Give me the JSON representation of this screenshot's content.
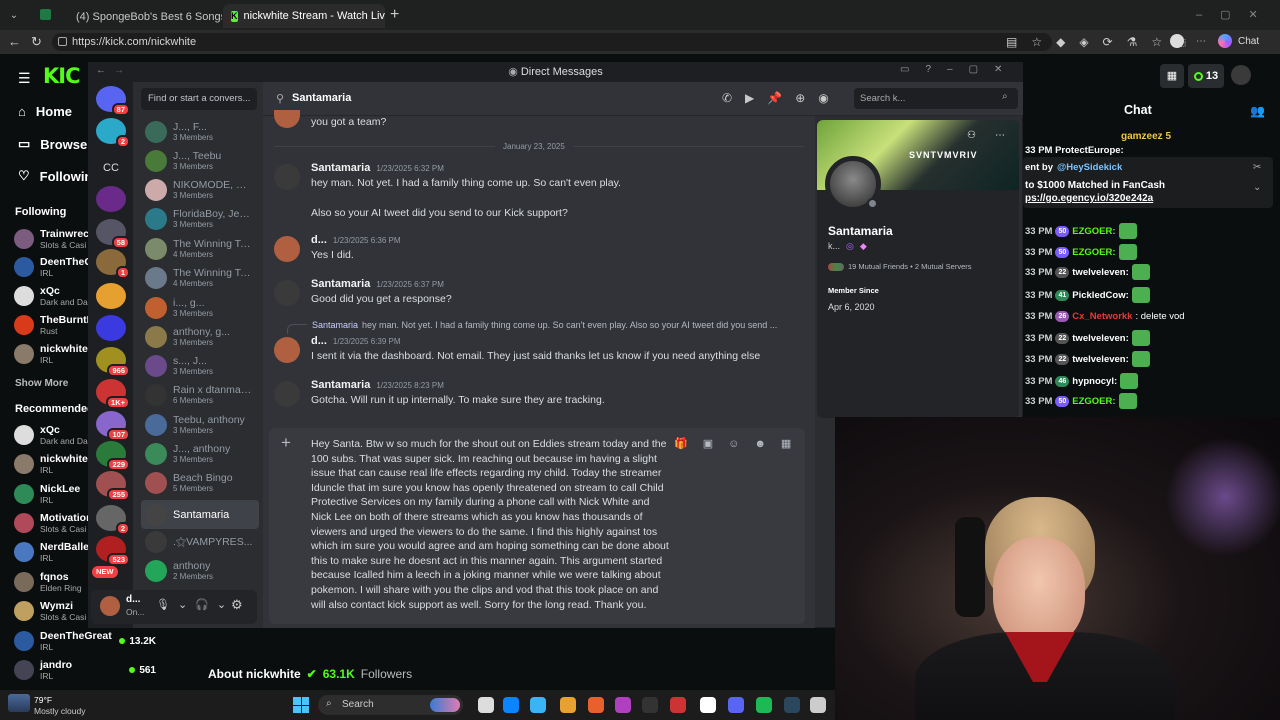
{
  "browser": {
    "tabs": [
      {
        "label": "(4) SpongeBob's Best 6 Songs 🇫🇷"
      },
      {
        "label": "nickwhite Stream - Watch Live on"
      }
    ],
    "url": "https://kick.com/nickwhite"
  },
  "kick": {
    "nav": [
      {
        "label": "Home"
      },
      {
        "label": "Browse"
      },
      {
        "label": "Following"
      }
    ],
    "following_title": "Following",
    "following": [
      {
        "name": "Trainwrec",
        "cat": "Slots & Casi"
      },
      {
        "name": "DeenTheG",
        "cat": "IRL"
      },
      {
        "name": "xQc",
        "cat": "Dark and Da"
      },
      {
        "name": "TheBurntP",
        "cat": "Rust"
      },
      {
        "name": "nickwhite",
        "cat": "IRL"
      }
    ],
    "show_more": "Show More",
    "recommended_title": "Recommended",
    "recommended": [
      {
        "name": "xQc",
        "cat": "Dark and Da",
        "count": ""
      },
      {
        "name": "nickwhite",
        "cat": "IRL",
        "count": ""
      },
      {
        "name": "NickLee",
        "cat": "IRL",
        "count": ""
      },
      {
        "name": "Motivation",
        "cat": "Slots & Casi",
        "count": ""
      },
      {
        "name": "NerdBaller",
        "cat": "IRL",
        "count": ""
      },
      {
        "name": "fqnos",
        "cat": "Elden Ring",
        "count": ""
      },
      {
        "name": "Wymzi",
        "cat": "Slots & Casi",
        "count": ""
      },
      {
        "name": "DeenTheGreat",
        "cat": "IRL",
        "count": "13.2K"
      },
      {
        "name": "jandro",
        "cat": "IRL",
        "count": "561"
      }
    ],
    "about": "About nickwhite",
    "followers_count": "63.1K",
    "followers_label": "Followers",
    "viewer_count": "13",
    "chat_title": "Chat",
    "chat_top": "gamzeez 5",
    "pinned_user": "@HeySidekick",
    "pinned_line1": "to $1000 Matched in FanCash",
    "pinned_line2": "ps://go.egency.io/320e242a",
    "pinned_prefix": "ent by",
    "chat_lines": [
      {
        "time": "33 PM",
        "badge": "50",
        "user": "EZGOER:",
        "color": "#53fc18",
        "msg": ""
      },
      {
        "time": "33 PM",
        "badge": "50",
        "user": "EZGOER:",
        "color": "#53fc18",
        "msg": ""
      },
      {
        "time": "33 PM",
        "badge": "22",
        "user": "twelveleven:",
        "color": "#ffffff",
        "msg": ""
      },
      {
        "time": "33 PM",
        "badge": "41",
        "user": "PickledCow:",
        "color": "#ffffff",
        "msg": ""
      },
      {
        "time": "33 PM",
        "badge": "26",
        "user": "Cx_Networkk",
        "color": "#e53935",
        "msg": ": delete vod"
      },
      {
        "time": "33 PM",
        "badge": "22",
        "user": "twelveleven:",
        "color": "#ffffff",
        "msg": ""
      },
      {
        "time": "33 PM",
        "badge": "22",
        "user": "twelveleven:",
        "color": "#ffffff",
        "msg": ""
      },
      {
        "time": "33 PM",
        "badge": "46",
        "user": "hypnocyl:",
        "color": "#ffffff",
        "msg": ""
      },
      {
        "time": "33 PM",
        "badge": "50",
        "user": "EZGOER:",
        "color": "#53fc18",
        "msg": ""
      }
    ],
    "chat_header_line": "33 PM ProtectEurope:"
  },
  "discord": {
    "window_title": "Direct Messages",
    "search_dm": "Find or start a convers...",
    "channel_name": "Santamaria",
    "search_placeholder": "Search k...",
    "server_badges": [
      "87",
      "2",
      "",
      "",
      "58",
      "1",
      "",
      "",
      "966",
      "1K+",
      "107",
      "229",
      "255",
      "2",
      "523"
    ],
    "new_label": "NEW",
    "cc_label": "CC",
    "dms": [
      {
        "name": "J..., F...",
        "members": "3 Members"
      },
      {
        "name": "J..., Teebu",
        "members": "3 Members"
      },
      {
        "name": "NIKOMODE, Ba...",
        "members": "3 Members"
      },
      {
        "name": "FloridaBoy, Jed...",
        "members": "3 Members"
      },
      {
        "name": "The Winning Te...",
        "members": "4 Members"
      },
      {
        "name": "The Winning Te...",
        "members": "4 Members"
      },
      {
        "name": "i..., g...",
        "members": "3 Members"
      },
      {
        "name": "anthony, g...",
        "members": "3 Members"
      },
      {
        "name": "s..., J...",
        "members": "3 Members"
      },
      {
        "name": "Rain x dtanmanb...",
        "members": "6 Members"
      },
      {
        "name": "Teebu, anthony",
        "members": "3 Members"
      },
      {
        "name": "J..., anthony",
        "members": "3 Members"
      },
      {
        "name": "Beach Bingo",
        "members": "5 Members"
      },
      {
        "name": "Santamaria",
        "members": ""
      },
      {
        "name": ".⚝VAMPYRES...",
        "members": ""
      },
      {
        "name": "anthony",
        "members": "2 Members"
      }
    ],
    "user": {
      "name": "d...",
      "status": "On..."
    },
    "date_divider": "January 23, 2025",
    "prev_text": "you got a team?",
    "messages": [
      {
        "author": "Santamaria",
        "time": "1/23/2025 6:32 PM",
        "lines": [
          "hey man.  Not yet. I had a family thing come up.  So can't even play.",
          "",
          "Also so your AI tweet did you send to our Kick support?"
        ]
      },
      {
        "author": "d...",
        "time": "1/23/2025 6:36 PM",
        "lines": [
          "Yes I did."
        ]
      },
      {
        "author": "Santamaria",
        "time": "1/23/2025 6:37 PM",
        "lines": [
          "Good did you get a response?"
        ]
      },
      {
        "author": "d...",
        "time": "1/23/2025 6:39 PM",
        "lines": [
          "I sent it via the dashboard. Not email. They just said thanks let us know if you need anything else"
        ]
      },
      {
        "author": "Santamaria",
        "time": "1/23/2025 8:23 PM",
        "lines": [
          "Gotcha. Will run it up internally. To make sure they are tracking."
        ]
      }
    ],
    "reply_author": "Santamaria",
    "reply_text": "hey man.  Not yet. I had a family thing come up.  So can't even play.  Also so your AI tweet did you send ...",
    "draft": "Hey Santa. Btw w so much for the shout out on Eddies stream today and the 100 subs. That was super sick. Im reaching out because im having a slight issue that can cause real life effects regarding my child. Today the streamer Iduncle that im sure you know has openly threatened on stream to call Child Protective Services on my family during a phone call with Nick White and Nick Lee on both of there streams which as you know has thousands of viewers and urged the viewers to do the same. I find this highly against tos which im sure you would agree and am hoping something can be done about this to make sure he doesnt act in this manner again.  This argument started because Icalled him a leech in a joking manner while we were talking about pokemon. I will share with you the clips and vod that this took place on and will also contact kick support as well. Sorry for the long read. Thank you.",
    "profile": {
      "name": "Santamaria",
      "tag": "k...",
      "mutual": "19 Mutual Friends • 2 Mutual Servers",
      "member_since_label": "Member Since",
      "member_since": "Apr 6, 2020",
      "banner_text": "SVNTVMVRIV"
    }
  },
  "taskbar": {
    "weather_temp": "79°F",
    "weather_desc": "Mostly cloudy",
    "search": "Search"
  },
  "colors": {
    "kick_green": "#53fc18",
    "discord_bg": "#313338",
    "blurple": "#5865f2"
  }
}
